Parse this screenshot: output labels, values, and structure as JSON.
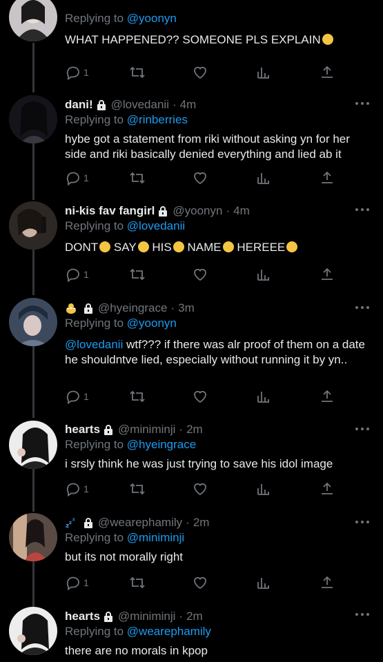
{
  "tweets": [
    {
      "name": "",
      "handle": "",
      "time": "",
      "replying_prefix": "Replying to ",
      "replying_to": "@yoonyn",
      "text_parts": [
        "WHAT HAPPENED?? SOMEONE PLS EXPLAIN"
      ],
      "replies": "1"
    },
    {
      "name": "dani!",
      "handle": "@lovedanii",
      "dot": "·",
      "time": "4m",
      "replying_prefix": "Replying to ",
      "replying_to": "@rinberries",
      "text": "hybe got a statement from riki without asking yn for her side and riki basically denied everything and lied ab it",
      "replies": "1"
    },
    {
      "name": "ni-kis fav fangirl",
      "handle": "@yoonyn",
      "dot": "·",
      "time": "4m",
      "replying_prefix": "Replying to ",
      "replying_to": "@lovedanii",
      "text_words": [
        "DONT",
        "SAY",
        "HIS",
        "NAME",
        "HEREEE"
      ],
      "replies": "1"
    },
    {
      "name": "",
      "handle": "@hyeingrace",
      "dot": "·",
      "time": "3m",
      "replying_prefix": "Replying to ",
      "replying_to": "@yoonyn",
      "text_mention": "@lovedanii",
      "text": " wtf??? if there was alr proof of them on a date he shouldntve lied, especially without running it by yn..",
      "replies": "1"
    },
    {
      "name": "hearts",
      "handle": "@miniminji",
      "dot": "·",
      "time": "2m",
      "replying_prefix": "Replying to ",
      "replying_to": "@hyeingrace",
      "text": "i srsly think he was just trying to save his idol image",
      "replies": "1"
    },
    {
      "name": "",
      "handle": "@wearephamily",
      "dot": "·",
      "time": "2m",
      "replying_prefix": "Replying to ",
      "replying_to": "@miniminji",
      "text": "but its not morally right",
      "replies": "1"
    },
    {
      "name": "hearts",
      "handle": "@miniminji",
      "dot": "·",
      "time": "2m",
      "replying_prefix": "Replying to ",
      "replying_to": "@wearephamily",
      "text": "there are no morals in kpop"
    }
  ],
  "icons": {
    "reply": "reply-icon",
    "retweet": "retweet-icon",
    "like": "heart-icon",
    "views": "views-icon",
    "share": "share-icon",
    "more": "more-icon",
    "lock": "lock-icon"
  },
  "colors": {
    "background": "#000000",
    "text": "#e7e9ea",
    "muted": "#71767b",
    "link": "#1d9bf0",
    "thread_line": "#333639"
  }
}
